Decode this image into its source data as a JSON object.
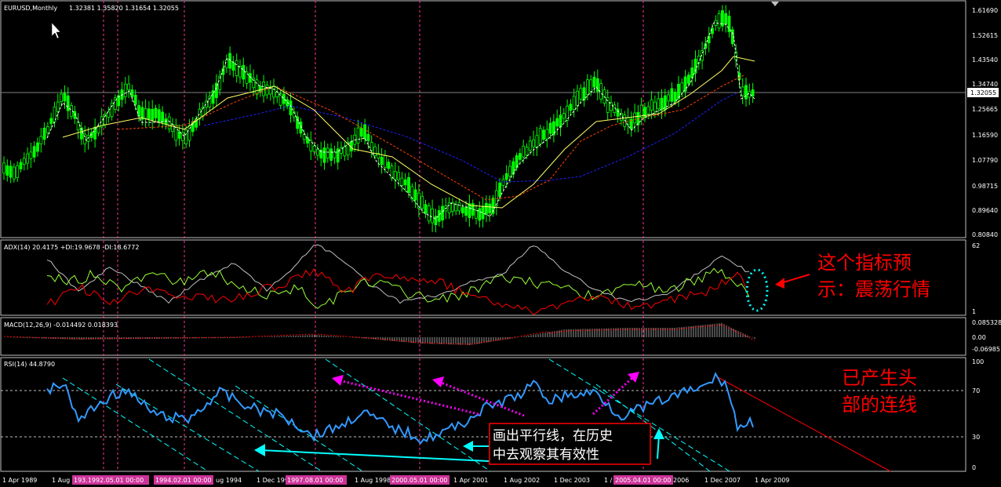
{
  "panels": {
    "price": {
      "title": "EURUSD,Monthly",
      "ohlc": "1.32381 1.35820 1.31654 1.32055"
    },
    "adx": {
      "title": "ADX(14) 20.4175 +DI:19.9678 -DI:18.6772"
    },
    "macd": {
      "title": "MACD(12,26,9) -0.014492 0.018393"
    },
    "rsi": {
      "title": "RSI(14) 44.8790"
    }
  },
  "price_scale": [
    "1.61690",
    "1.52615",
    "1.43540",
    "1.34740",
    "1.25665",
    "1.16590",
    "1.07790",
    "0.98715",
    "0.89640",
    "0.80840"
  ],
  "current_price": "1.32055",
  "adx_scale": [
    "62",
    "1"
  ],
  "macd_scale": [
    "0.085328",
    "0.00",
    "-0.06985"
  ],
  "rsi_scale": [
    "100",
    "70",
    "30",
    "0"
  ],
  "time_axis": [
    "1 Apr 1989",
    "1 Aug",
    "1 Dec 199",
    "1 Aug 1998",
    "1 Apr 2001",
    "1 Aug 2002",
    "1 Dec 2003",
    "1 /",
    "2006",
    "1 Dec 2007",
    "1 Apr 2009",
    "ug 1994"
  ],
  "time_markers": [
    "193.1992.05.01 00:00",
    "1994.02.01 00:00",
    "1997.08.01 00:00",
    "2000.05.01 00:00",
    "2005.04.01 00:00"
  ],
  "annotations": {
    "adx_note": [
      "这个指标预",
      "示：震荡行情"
    ],
    "rsi_note": [
      "已产生头",
      "部的连线"
    ],
    "box_note": [
      "画出平行线，在历史",
      "中去观察其有效性"
    ]
  },
  "colors": {
    "candle": "#00ff00",
    "ma_fast": "#ffffff",
    "ma_yellow": "#ffff66",
    "ma_red": "#ff4400",
    "ma_blue": "#2020ff",
    "adx_line": "#c0c0c0",
    "plus_di": "#99ff33",
    "minus_di": "#ff0000",
    "rsi_line": "#3399ff",
    "cyan": "#00ffff",
    "magenta": "#ff00ff",
    "annot_red": "#ff0000",
    "marker": "#ff3399"
  }
}
